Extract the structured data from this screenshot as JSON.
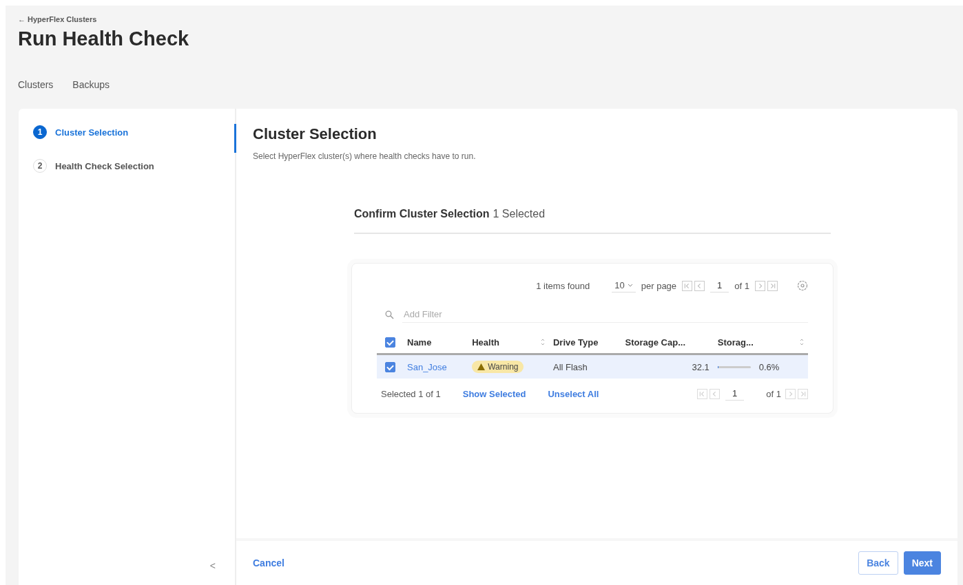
{
  "breadcrumb": {
    "arrow": "←",
    "label": "HyperFlex Clusters"
  },
  "title": "Run Health Check",
  "tabs": [
    {
      "label": "Clusters",
      "selected": false
    },
    {
      "label": "Backups",
      "selected": false
    }
  ],
  "steps": [
    {
      "number": "1",
      "label": "Cluster Selection",
      "selected": true
    },
    {
      "number": "2",
      "label": "Health Check Selection",
      "selected": false
    }
  ],
  "collapse": "<",
  "section": {
    "title": "Cluster Selection",
    "subtitle": "Select HyperFlex cluster(s) where health checks have to run."
  },
  "confirm": {
    "title": "Confirm Cluster Selection",
    "count": "1 Selected"
  },
  "table": {
    "items_found": "1 items found",
    "per_page_value": "10",
    "per_page_label": "per page",
    "page": "1",
    "of_pages": "of 1",
    "filter_placeholder": "Add Filter",
    "all_checked": true,
    "columns": [
      {
        "label": "Name",
        "sortable": false
      },
      {
        "label": "Health",
        "sortable": true
      },
      {
        "label": "Drive Type",
        "sortable": false
      },
      {
        "label": "Storage Cap...",
        "sortable": false
      },
      {
        "label": "Storag...",
        "sortable": true
      }
    ],
    "rows": [
      {
        "selected": true,
        "checked": true,
        "name": "San_Jose",
        "health": "Warning",
        "drive_type": "All Flash",
        "storage_capacity": "32.1",
        "level": 0.006,
        "utilization": "0.6%"
      }
    ],
    "selected_text": "Selected 1 of 1",
    "show_selected": "Show Selected",
    "unselect_all": "Unselect All",
    "footer_page": "1",
    "footer_of": "of 1"
  },
  "footer": {
    "cancel": "Cancel",
    "back": "Back",
    "next": "Next"
  }
}
